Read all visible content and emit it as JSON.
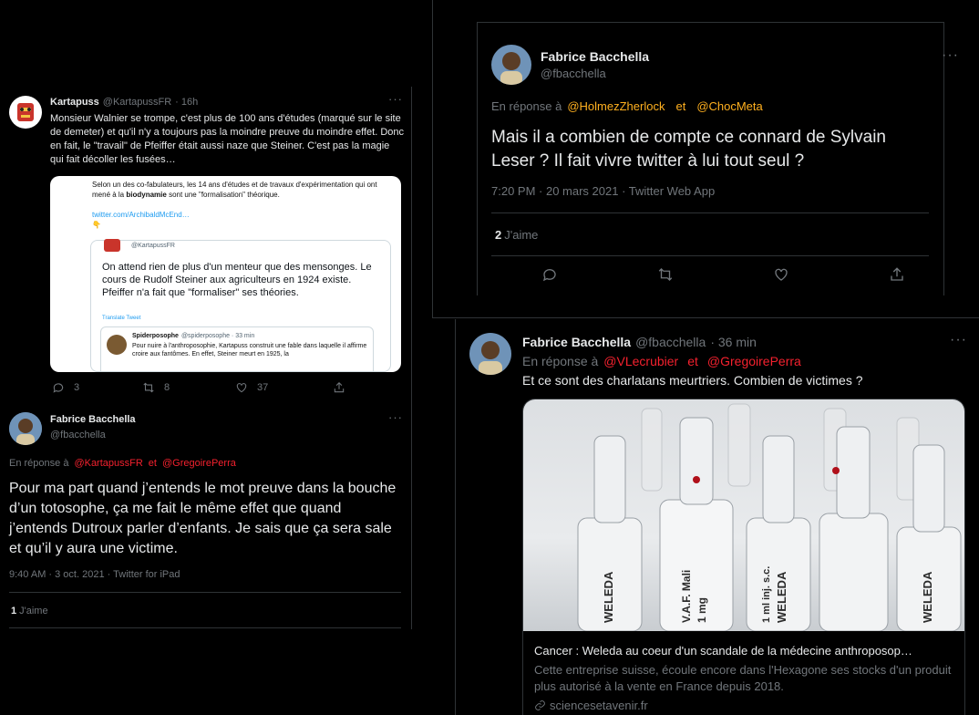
{
  "left": {
    "tweet1": {
      "name": "Kartapuss",
      "handle": "@KartapussFR",
      "time": "· 16h",
      "text": "Monsieur Walnier se trompe, c'est plus de 100 ans d'études (marqué sur le site de demeter) et qu'il n'y a toujours pas la moindre preuve du moindre effet. Donc en fait, le \"travail\" de Pfeiffer était aussi naze que Steiner. C'est pas la magie qui fait décoller les fusées…",
      "embed": {
        "line1": "Selon un des co-fabulateurs, les 14 ans d'études et de travaux d'expérimentation qui ont mené à la",
        "bold_word": "biodynamie",
        "line1_end": "sont une \"formalisation\" théorique.",
        "link": "twitter.com/ArchibaldMcEnd…",
        "emoji": "👇",
        "inner_handle": "@KartapussFR",
        "inner_text": "On attend rien de plus d'un menteur que des mensonges. Le cours de Rudolf Steiner aux agriculteurs en 1924 existe. Pfeiffer n'a fait que \"formaliser\" ses théories.",
        "translate": "Translate Tweet",
        "nested_name": "Spiderposophe",
        "nested_handle": "@spiderposophe · 33 min",
        "nested_text": "Pour nuire à l'anthroposophie, Kartapuss construit une fable dans laquelle il affirme croire aux fantômes. En effet, Steiner meurt en 1925, la"
      },
      "replies": "3",
      "retweets": "8",
      "likes": "37"
    },
    "tweet2": {
      "name": "Fabrice Bacchella",
      "handle": "@fbacchella",
      "reply_prefix": "En réponse à",
      "reply_user1": "@KartapussFR",
      "reply_and": "et",
      "reply_user2": "@GregoirePerra",
      "text": "Pour ma part quand j’entends le mot preuve dans la bouche d’un totosophe, ça me fait le même effet que quand j’entends Dutroux parler d’enfants. Je sais que ça sera sale et qu’il y aura une victime.",
      "meta": "9:40 AM · 3 oct. 2021 · Twitter for iPad",
      "likes_count": "1",
      "likes_label": "J'aime"
    }
  },
  "topright": {
    "name": "Fabrice Bacchella",
    "handle": "@fbacchella",
    "reply_prefix": "En réponse à",
    "reply_user1": "@HolmezZherlock",
    "reply_and": "et",
    "reply_user2": "@ChocMeta",
    "text": "Mais il a combien de compte ce connard de Sylvain Leser ? Il fait vivre twitter à lui tout seul ?",
    "meta": "7:20 PM · 20 mars 2021 · Twitter Web App",
    "likes_count": "2",
    "likes_label": "J'aime"
  },
  "bottomright": {
    "name": "Fabrice Bacchella",
    "handle": "@fbacchella",
    "time": "· 36 min",
    "reply_prefix": "En réponse à",
    "reply_user1": "@VLecrubier",
    "reply_and": "et",
    "reply_user2": "@GregoirePerra",
    "text": "Et ce sont des charlatans meurtriers. Combien de victimes ?",
    "card": {
      "title": "Cancer : Weleda au coeur d'un scandale de la médecine anthroposop…",
      "desc": "Cette entreprise suisse, écoule encore dans l'Hexagone ses stocks d'un produit plus autorisé à la vente en France depuis 2018.",
      "domain": "sciencesetavenir.fr",
      "vial_labels": [
        "WELEDA",
        "V.A.F. Mali",
        "1 mg",
        "1 ml inj. s.c.",
        "WELEDA",
        "WELEDA"
      ]
    }
  },
  "colors": {
    "mention_red": "#f4212e",
    "mention_yellow": "#ffb01f",
    "muted": "#71767b"
  }
}
